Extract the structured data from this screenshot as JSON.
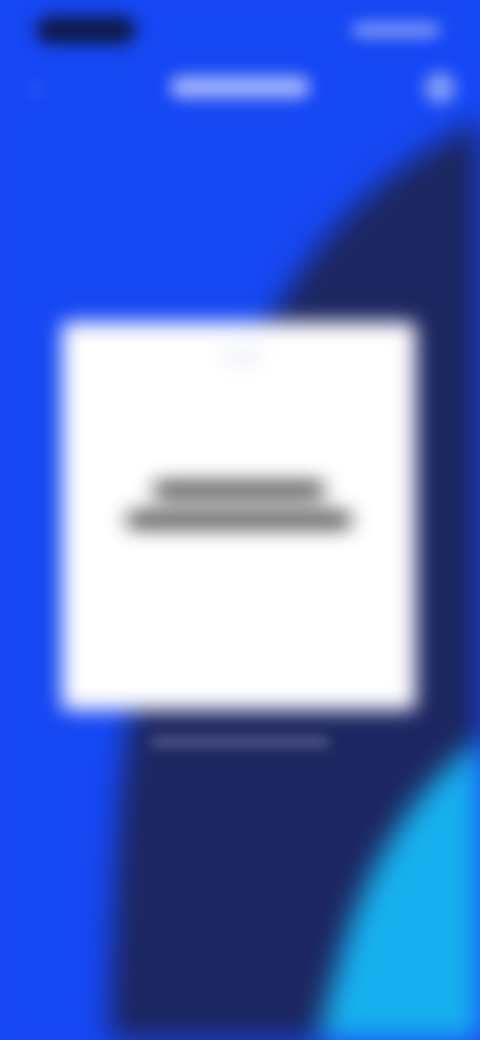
{
  "app": {
    "title": "",
    "colors": {
      "primary_blue": "#1648f3",
      "navy": "#1c2660",
      "sky": "#17b0ee",
      "card": "#ffffff"
    }
  },
  "status_bar": {
    "time": "",
    "icons": ""
  },
  "header": {
    "back_icon": "chevron-left-icon",
    "back_glyph": "‹",
    "title": "",
    "action_icon": "profile-icon"
  },
  "card": {
    "line1": "",
    "line2": ""
  },
  "caption": {
    "text": ""
  }
}
